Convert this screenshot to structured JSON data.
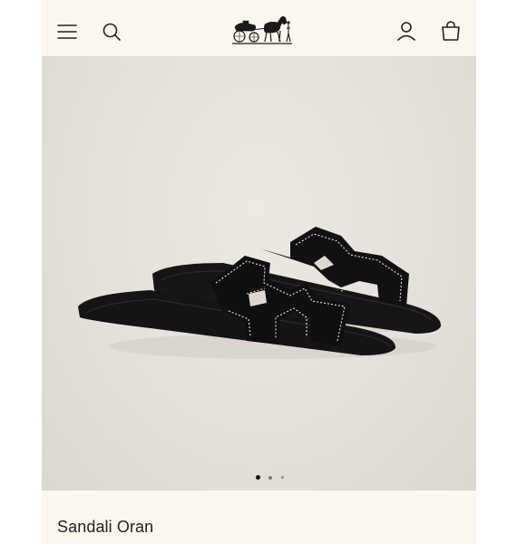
{
  "header": {
    "icons": [
      "menu-icon",
      "search-icon",
      "account-icon",
      "shopping-bag-icon"
    ],
    "logo": "horse-and-carriage-logo"
  },
  "carousel": {
    "slide_count": 3,
    "active_slide": 1
  },
  "product": {
    "title": "Sandali Oran"
  },
  "colors": {
    "background": "#fbf6ee",
    "hero_background": "#e4e1da",
    "leather": "#121212",
    "stitching": "#e9e5dc"
  }
}
